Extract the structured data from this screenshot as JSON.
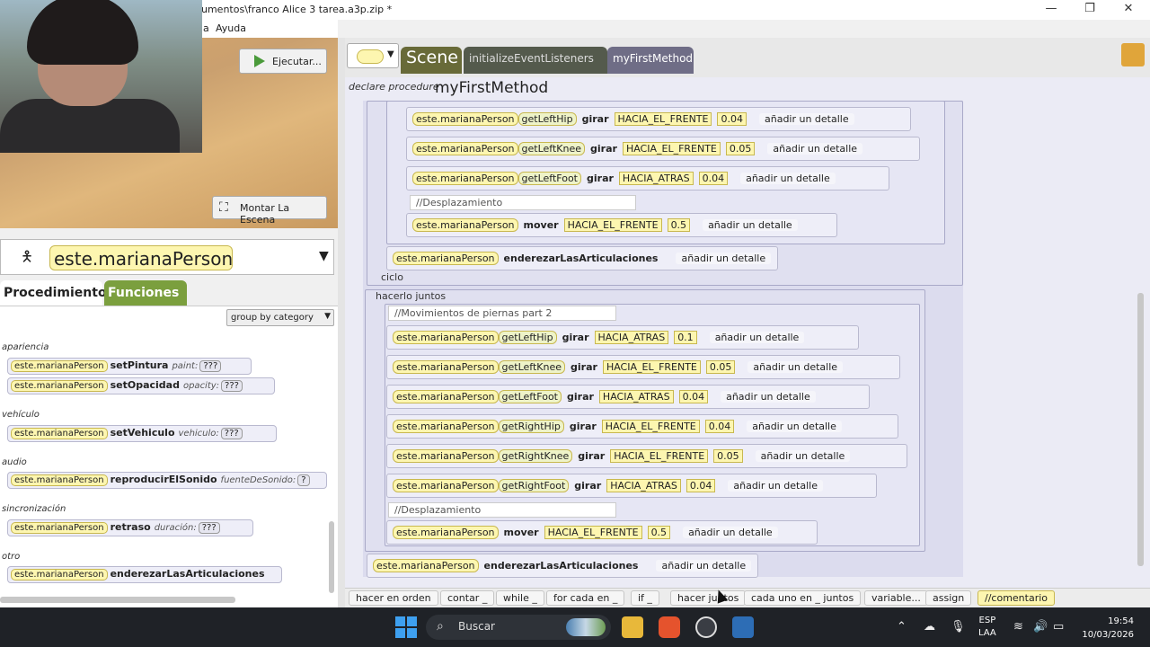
{
  "window": {
    "title": "umentos\\franco Alice 3 tarea.a3p.zip *",
    "minimize": "—",
    "maximize": "❐",
    "close": "✕"
  },
  "menu": [
    "a",
    "Ayuda"
  ],
  "scene_view": {
    "run_label": "Ejecutar...",
    "setup_label": "Montar La Escena"
  },
  "selector": {
    "name": "este.marianaPerson"
  },
  "left_tabs": {
    "procedures": "Procedimiento",
    "functions": "Funciones"
  },
  "group_by": "group by category",
  "procedures": [
    {
      "category": "apariencia",
      "method": "setPintura",
      "param": "paint:",
      "value": "???"
    },
    {
      "category": "",
      "method": "setOpacidad",
      "param": "opacity:",
      "value": "???"
    },
    {
      "category": "vehículo",
      "method": "setVehiculo",
      "param": "vehiculo:",
      "value": "???"
    },
    {
      "category": "audio",
      "method": "reproducirElSonido",
      "param": "fuenteDeSonido:",
      "value": "?"
    },
    {
      "category": "sincronización",
      "method": "retraso",
      "param": "duración:",
      "value": "???"
    },
    {
      "category": "otro",
      "method": "enderezarLasArticulaciones",
      "param": "",
      "value": ""
    }
  ],
  "proc_target": "este.marianaPerson",
  "editor_tabs": {
    "scene": "Scene",
    "init": "initializeEventListeners",
    "first": "myFirstMethod"
  },
  "declare": {
    "prefix": "declare procedure",
    "name": "myFirstMethod"
  },
  "code": {
    "target": "este.marianaPerson",
    "turn": "girar",
    "move": "mover",
    "straighten": "enderezarLasArticulaciones",
    "add_detail": "añadir un detalle",
    "loop_label": "ciclo",
    "together_label": "hacerlo juntos",
    "comment_move": "//Desplazamiento",
    "comment_legs": "//Movimientos de piernas part 2",
    "loop_turns": [
      {
        "joint": "getLeftHip",
        "dir": "HACIA_EL_FRENTE",
        "amount": "0.04"
      },
      {
        "joint": "getLeftKnee",
        "dir": "HACIA_EL_FRENTE",
        "amount": "0.05"
      },
      {
        "joint": "getLeftFoot",
        "dir": "HACIA_ATRAS",
        "amount": "0.04"
      }
    ],
    "loop_move": {
      "dir": "HACIA_EL_FRENTE",
      "amount": "0.5"
    },
    "together_turns": [
      {
        "joint": "getLeftHip",
        "dir": "HACIA_ATRAS",
        "amount": "0.1"
      },
      {
        "joint": "getLeftKnee",
        "dir": "HACIA_EL_FRENTE",
        "amount": "0.05"
      },
      {
        "joint": "getLeftFoot",
        "dir": "HACIA_ATRAS",
        "amount": "0.04"
      },
      {
        "joint": "getRightHip",
        "dir": "HACIA_EL_FRENTE",
        "amount": "0.04"
      },
      {
        "joint": "getRightKnee",
        "dir": "HACIA_EL_FRENTE",
        "amount": "0.05"
      },
      {
        "joint": "getRightFoot",
        "dir": "HACIA_ATRAS",
        "amount": "0.04"
      }
    ],
    "together_move": {
      "dir": "HACIA_EL_FRENTE",
      "amount": "0.5"
    }
  },
  "bottom_bar": [
    "hacer en orden",
    "contar _",
    "while _",
    "for cada en _",
    "if _",
    "hacer juntos",
    "cada uno en _ juntos",
    "variable...",
    "assign",
    "//comentario"
  ],
  "taskbar": {
    "search": "Buscar",
    "lang1": "ESP",
    "lang2": "LAA",
    "time": "19:54",
    "date": "10/03/2026"
  },
  "colors": {
    "functions_tab": "#7b9f3e",
    "scene_tab": "#686a38",
    "tile": "#fdf6b0"
  }
}
